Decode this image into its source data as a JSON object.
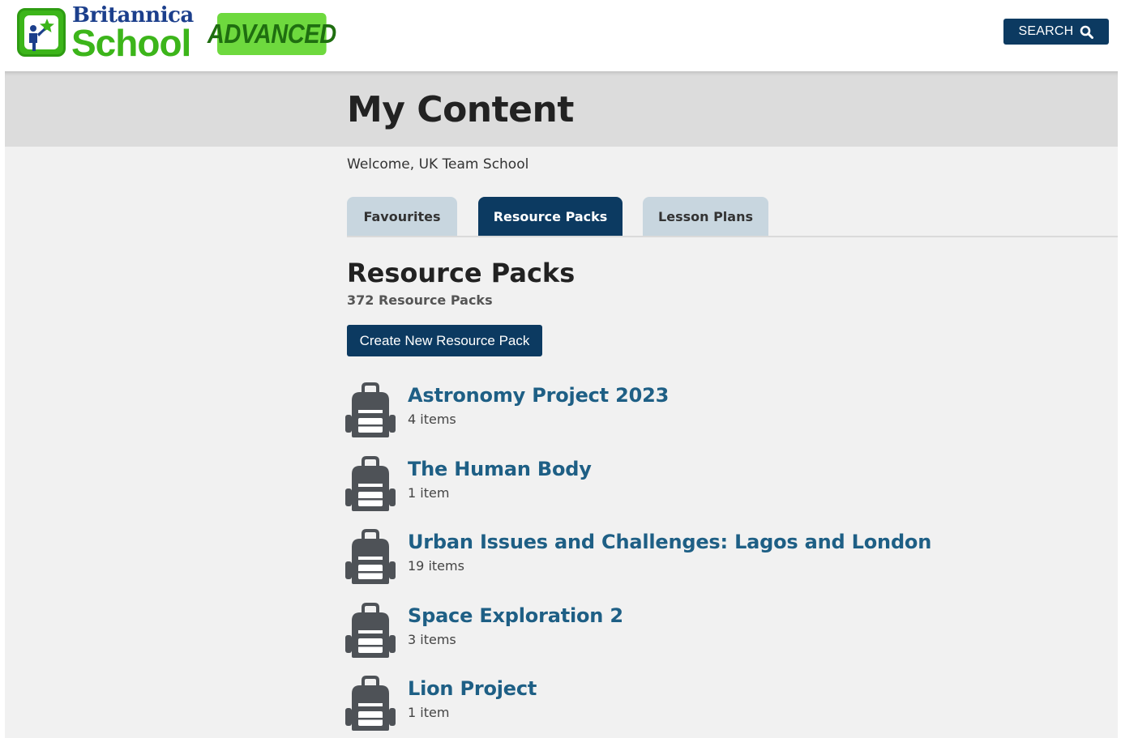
{
  "header": {
    "logo": {
      "brand_top": "Britannica",
      "brand_main": "School",
      "badge": "ADVANCED",
      "colors": {
        "green": "#3cb51a",
        "navy": "#1c3f8c",
        "badge_bg": "#6ed93e"
      }
    },
    "search": {
      "label": "SEARCH",
      "icon": "search-icon"
    }
  },
  "page": {
    "title": "My Content",
    "welcome": "Welcome, UK Team School"
  },
  "tabs": [
    {
      "label": "Favourites",
      "active": false
    },
    {
      "label": "Resource Packs",
      "active": true
    },
    {
      "label": "Lesson Plans",
      "active": false
    }
  ],
  "section": {
    "title": "Resource Packs",
    "count": "372 Resource Packs",
    "create_button": "Create New Resource Pack"
  },
  "packs": [
    {
      "title": "Astronomy Project 2023",
      "count": "4 items",
      "icon": "backpack-icon"
    },
    {
      "title": "The Human Body",
      "count": "1 item",
      "icon": "backpack-icon"
    },
    {
      "title": "Urban Issues and Challenges: Lagos and London",
      "count": "19 items",
      "icon": "backpack-icon"
    },
    {
      "title": "Space Exploration 2",
      "count": "3 items",
      "icon": "backpack-icon"
    },
    {
      "title": "Lion Project",
      "count": "1 item",
      "icon": "backpack-icon"
    }
  ],
  "colors": {
    "primary": "#0c3a61",
    "link": "#1e5f85",
    "tab_inactive": "#c8d6df",
    "band": "#dcdcdc",
    "background": "#f1f1f1"
  }
}
